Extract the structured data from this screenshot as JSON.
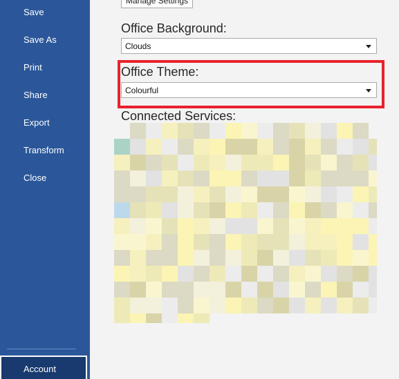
{
  "sidebar": {
    "items": [
      {
        "label": "Save"
      },
      {
        "label": "Save As"
      },
      {
        "label": "Print"
      },
      {
        "label": "Share"
      },
      {
        "label": "Export"
      },
      {
        "label": "Transform"
      },
      {
        "label": "Close"
      }
    ],
    "account_label": "Account"
  },
  "main": {
    "manage_settings_label": "Manage Settings",
    "background": {
      "label": "Office Background:",
      "value": "Clouds"
    },
    "theme": {
      "label": "Office Theme:",
      "value": "Colourful"
    },
    "connected_services": {
      "label": "Connected Services:"
    }
  },
  "colors": {
    "sidebar_bg": "#2b579a",
    "account_bg": "#183a6e",
    "highlight": "#e8222d",
    "main_bg": "#f3f3f3"
  }
}
